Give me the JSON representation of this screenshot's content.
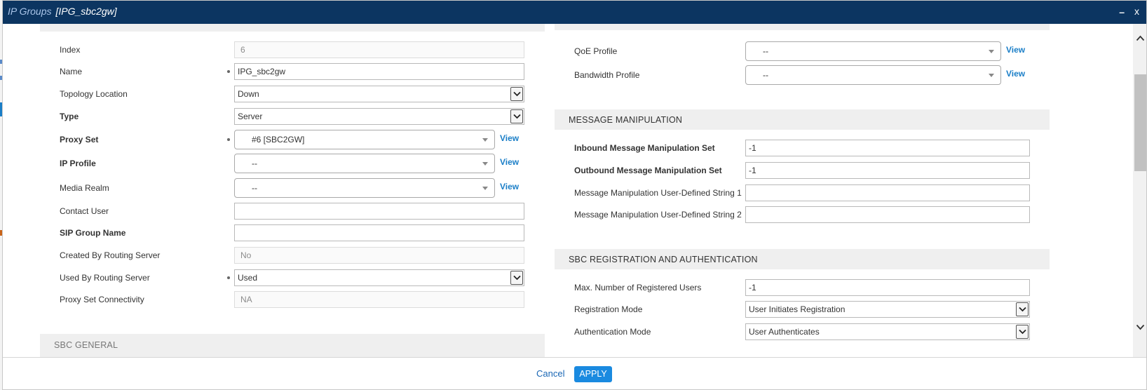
{
  "dialog": {
    "title_prefix": "IP Groups",
    "title_name": "[IPG_sbc2gw]",
    "minimize_label": "–",
    "close_label": "x"
  },
  "left": {
    "fields": {
      "index": {
        "label": "Index",
        "value": "6"
      },
      "name": {
        "label": "Name",
        "value": "IPG_sbc2gw"
      },
      "topology": {
        "label": "Topology Location",
        "value": "Down"
      },
      "type": {
        "label": "Type",
        "value": "Server"
      },
      "proxy_set": {
        "label": "Proxy Set",
        "value": "#6 [SBC2GW]",
        "link": "View"
      },
      "ip_profile": {
        "label": "IP Profile",
        "value": "--",
        "link": "View"
      },
      "media_realm": {
        "label": "Media Realm",
        "value": "--",
        "link": "View"
      },
      "contact_user": {
        "label": "Contact User",
        "value": ""
      },
      "sip_group_name": {
        "label": "SIP Group Name",
        "value": ""
      },
      "created_by_rs": {
        "label": "Created By Routing Server",
        "value": "No"
      },
      "used_by_rs": {
        "label": "Used By Routing Server",
        "value": "Used"
      },
      "proxy_conn": {
        "label": "Proxy Set Connectivity",
        "value": "NA"
      }
    },
    "next_section_title": "SBC GENERAL"
  },
  "right": {
    "qoe_profile": {
      "label": "QoE Profile",
      "value": "--",
      "link": "View"
    },
    "bandwidth_profile": {
      "label": "Bandwidth Profile",
      "value": "--",
      "link": "View"
    },
    "msg_section_title": "MESSAGE MANIPULATION",
    "msg": {
      "inbound": {
        "label": "Inbound Message Manipulation Set",
        "value": "-1"
      },
      "outbound": {
        "label": "Outbound Message Manipulation Set",
        "value": "-1"
      },
      "user_str1": {
        "label": "Message Manipulation User-Defined String 1",
        "value": ""
      },
      "user_str2": {
        "label": "Message Manipulation User-Defined String 2",
        "value": ""
      }
    },
    "reg_section_title": "SBC REGISTRATION AND AUTHENTICATION",
    "reg": {
      "max_users": {
        "label": "Max. Number of Registered Users",
        "value": "-1"
      },
      "reg_mode": {
        "label": "Registration Mode",
        "value": "User Initiates Registration"
      },
      "auth_mode": {
        "label": "Authentication Mode",
        "value": "User Authenticates"
      }
    }
  },
  "footer": {
    "cancel_label": "Cancel",
    "apply_label": "APPLY"
  },
  "colors": {
    "titlebar": "#0c3561",
    "link": "#1a7ec7",
    "apply": "#1a8ae0"
  }
}
